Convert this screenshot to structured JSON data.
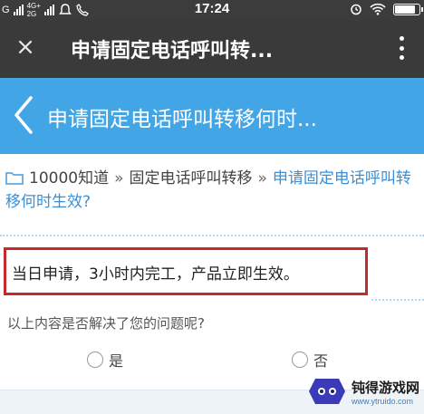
{
  "status_bar": {
    "carrier_left": "G",
    "net_top": "4G+",
    "net_bottom": "2G",
    "time": "17:24",
    "battery_level": 0.85
  },
  "toolbar": {
    "close_glyph": "×",
    "title": "申请固定电话呼叫转...",
    "more_icon": "more-vertical-icon"
  },
  "page": {
    "title": "申请固定电话呼叫转移何时..."
  },
  "breadcrumb": {
    "items": [
      "10000知道",
      "固定电话呼叫转移"
    ],
    "separator": "»",
    "current": "申请固定电话呼叫转移何时生效?"
  },
  "notice": {
    "text": "当日申请，3小时内完工，产品立即生效。"
  },
  "feedback": {
    "question": "以上内容是否解决了您的问题呢?",
    "yes": "是",
    "no": "否"
  },
  "watermark": {
    "name": "钝得游戏网",
    "url": "www.ytruido.com"
  },
  "colors": {
    "status_bar": "#3c3c3c",
    "toolbar": "#3a3a3a",
    "header": "#42a6e6",
    "link": "#3a8fd8",
    "highlight_border": "#c42a2a"
  }
}
